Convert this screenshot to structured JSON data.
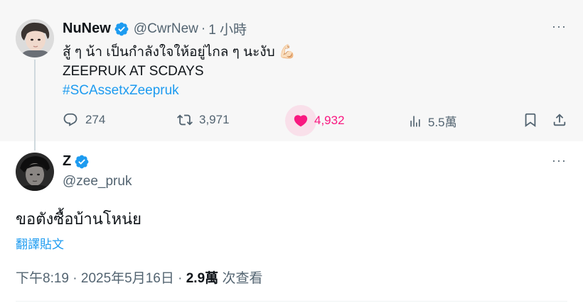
{
  "parent_tweet": {
    "display_name": "NuNew",
    "handle": "@CwrNew",
    "separator": "·",
    "time": "1 小時",
    "text_line_1": "สู้ ๆ น้า เป็นกำลังใจให้อยู่ไกล ๆ นะงับ",
    "text_line_1_emoji": "💪🏻",
    "text_line_2": "ZEEPRUK AT SCDAYS",
    "hashtag": "#SCAssetxZeepruk",
    "more_label": "···",
    "stats": {
      "replies": "274",
      "retweets": "3,971",
      "likes": "4,932",
      "views": "5.5萬"
    }
  },
  "main_tweet": {
    "display_name": "Z",
    "handle": "@zee_pruk",
    "more_label": "···",
    "text": "ขอตังซื้อบ้านโหน่ย",
    "translate_label": "翻譯貼文",
    "time": "下午8:19",
    "separator": "·",
    "date": "2025年5月16日",
    "separator2": "·",
    "views_count": "2.9萬",
    "views_label": "次查看"
  },
  "colors": {
    "accent": "#1d9bf0",
    "like": "#f91880",
    "secondary_text": "#536471",
    "parent_bg": "#f7f7f7"
  },
  "icons": {
    "verified": "verified-badge-icon",
    "reply": "reply-icon",
    "retweet": "retweet-icon",
    "like": "heart-icon",
    "views": "analytics-icon",
    "bookmark": "bookmark-icon",
    "share": "share-icon",
    "more": "more-icon"
  }
}
